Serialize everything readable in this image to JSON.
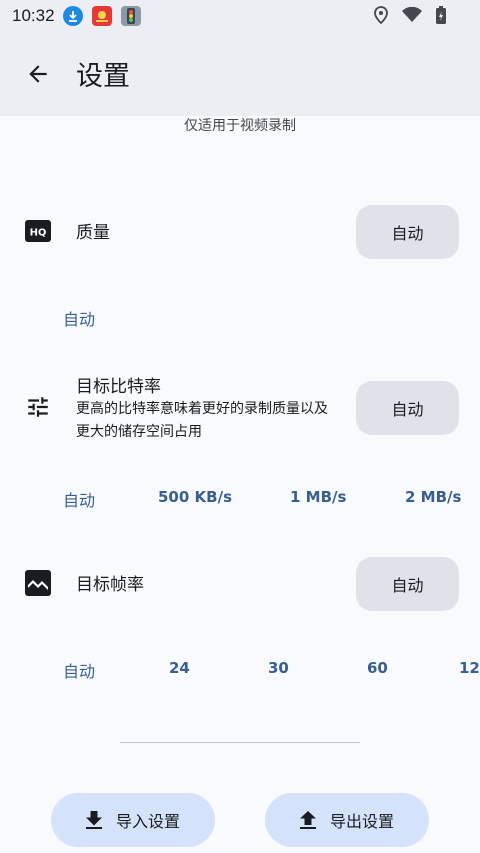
{
  "status": {
    "time": "10:32"
  },
  "appbar": {
    "title": "设置"
  },
  "hint": "仅适用于视频录制",
  "quality": {
    "title": "质量",
    "button_label": "自动",
    "current": "自动"
  },
  "bitrate": {
    "title": "目标比特率",
    "description": "更高的比特率意味着更好的录制质量以及更大的储存空间占用",
    "button_label": "自动",
    "options": [
      "自动",
      "500 KB/s",
      "1 MB/s",
      "2 MB/s"
    ]
  },
  "framerate": {
    "title": "目标帧率",
    "button_label": "自动",
    "options": [
      "自动",
      "24",
      "30",
      "60",
      "12"
    ]
  },
  "bottom": {
    "import_label": "导入设置",
    "export_label": "导出设置"
  },
  "colors": {
    "accent": "#385f8f",
    "appbar_bg": "#eceef4",
    "pill_bg": "#e1e2e9",
    "tonal_bg": "#d4e3fb"
  }
}
